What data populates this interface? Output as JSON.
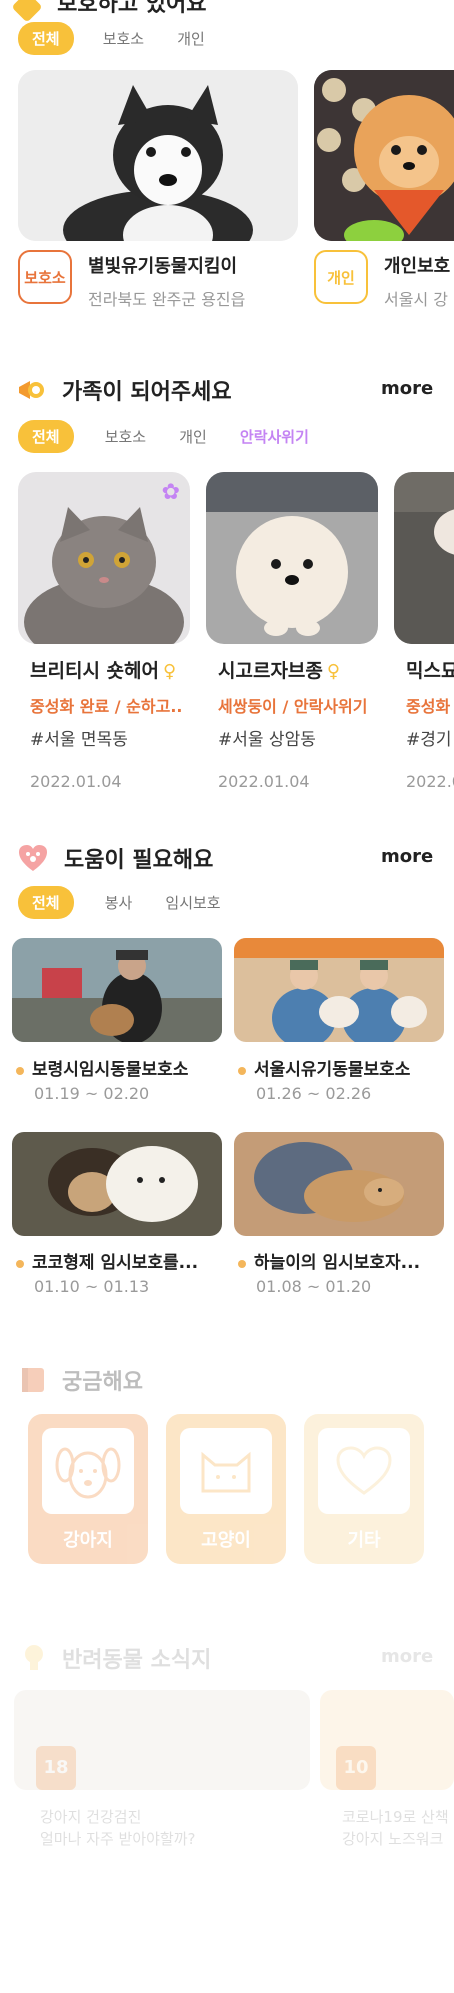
{
  "section_top": {
    "title_partial": "보호하고 있어요",
    "filters": [
      "전체",
      "보호소",
      "개인"
    ],
    "cards": [
      {
        "badge": "보호소",
        "name": "별빛유기동물지킴이",
        "location": "전라북도 완주군 용진읍"
      },
      {
        "badge": "개인",
        "name": "개인보호",
        "location": "서울시 강"
      }
    ]
  },
  "section_family": {
    "title": "가족이 되어주세요",
    "more": "more",
    "filters": [
      "전체",
      "보호소",
      "개인",
      "안락사위기"
    ],
    "cards": [
      {
        "name": "브리티시 숏헤어",
        "status": "중성화 완료 / 순하고..",
        "location": "#서울 면목동",
        "date": "2022.01.04",
        "gender_icon": "female-icon"
      },
      {
        "name": "시고르자브종",
        "status": "세쌍둥이 / 안락사위기",
        "location": "#서울 상암동",
        "date": "2022.01.04",
        "gender_icon": "female-icon"
      },
      {
        "name": "믹스묘",
        "status": "중성화",
        "location": "#경기",
        "date": "2022.0"
      }
    ]
  },
  "section_help": {
    "title": "도움이 필요해요",
    "more": "more",
    "filters": [
      "전체",
      "봉사",
      "임시보호"
    ],
    "items": [
      {
        "name": "보령시임시동물보호소",
        "dates": "01.19 ~ 02.20"
      },
      {
        "name": "서울시유기동물보호소",
        "dates": "01.26 ~ 02.26"
      },
      {
        "name": "코코형제 임시보호를...",
        "dates": "01.10 ~ 01.13"
      },
      {
        "name": "하늘이의 임시보호자...",
        "dates": "01.08 ~ 01.20"
      }
    ]
  },
  "section_faq": {
    "title": "궁금해요",
    "categories": [
      "강아지",
      "고양이",
      "기타"
    ]
  },
  "section_news": {
    "title": "반려동물 소식지",
    "more": "more",
    "items": [
      {
        "day": "18",
        "title_line1": "강아지 건강검진",
        "title_line2": "얼마나 자주 받아야할까?"
      },
      {
        "day": "10",
        "title_line1": "코로나19로 산책",
        "title_line2": "강아지 노즈워크"
      }
    ]
  },
  "colors": {
    "accent_yellow": "#f8c13a",
    "accent_orange": "#e8743b",
    "accent_purple": "#c484f3"
  }
}
